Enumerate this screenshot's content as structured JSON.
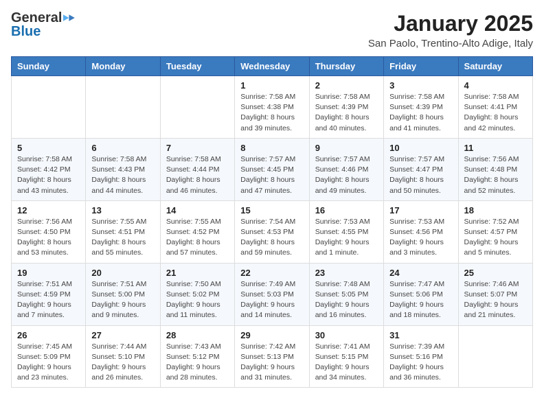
{
  "header": {
    "logo_general": "General",
    "logo_blue": "Blue",
    "month": "January 2025",
    "location": "San Paolo, Trentino-Alto Adige, Italy"
  },
  "weekdays": [
    "Sunday",
    "Monday",
    "Tuesday",
    "Wednesday",
    "Thursday",
    "Friday",
    "Saturday"
  ],
  "weeks": [
    [
      {
        "day": "",
        "info": ""
      },
      {
        "day": "",
        "info": ""
      },
      {
        "day": "",
        "info": ""
      },
      {
        "day": "1",
        "info": "Sunrise: 7:58 AM\nSunset: 4:38 PM\nDaylight: 8 hours\nand 39 minutes."
      },
      {
        "day": "2",
        "info": "Sunrise: 7:58 AM\nSunset: 4:39 PM\nDaylight: 8 hours\nand 40 minutes."
      },
      {
        "day": "3",
        "info": "Sunrise: 7:58 AM\nSunset: 4:39 PM\nDaylight: 8 hours\nand 41 minutes."
      },
      {
        "day": "4",
        "info": "Sunrise: 7:58 AM\nSunset: 4:41 PM\nDaylight: 8 hours\nand 42 minutes."
      }
    ],
    [
      {
        "day": "5",
        "info": "Sunrise: 7:58 AM\nSunset: 4:42 PM\nDaylight: 8 hours\nand 43 minutes."
      },
      {
        "day": "6",
        "info": "Sunrise: 7:58 AM\nSunset: 4:43 PM\nDaylight: 8 hours\nand 44 minutes."
      },
      {
        "day": "7",
        "info": "Sunrise: 7:58 AM\nSunset: 4:44 PM\nDaylight: 8 hours\nand 46 minutes."
      },
      {
        "day": "8",
        "info": "Sunrise: 7:57 AM\nSunset: 4:45 PM\nDaylight: 8 hours\nand 47 minutes."
      },
      {
        "day": "9",
        "info": "Sunrise: 7:57 AM\nSunset: 4:46 PM\nDaylight: 8 hours\nand 49 minutes."
      },
      {
        "day": "10",
        "info": "Sunrise: 7:57 AM\nSunset: 4:47 PM\nDaylight: 8 hours\nand 50 minutes."
      },
      {
        "day": "11",
        "info": "Sunrise: 7:56 AM\nSunset: 4:48 PM\nDaylight: 8 hours\nand 52 minutes."
      }
    ],
    [
      {
        "day": "12",
        "info": "Sunrise: 7:56 AM\nSunset: 4:50 PM\nDaylight: 8 hours\nand 53 minutes."
      },
      {
        "day": "13",
        "info": "Sunrise: 7:55 AM\nSunset: 4:51 PM\nDaylight: 8 hours\nand 55 minutes."
      },
      {
        "day": "14",
        "info": "Sunrise: 7:55 AM\nSunset: 4:52 PM\nDaylight: 8 hours\nand 57 minutes."
      },
      {
        "day": "15",
        "info": "Sunrise: 7:54 AM\nSunset: 4:53 PM\nDaylight: 8 hours\nand 59 minutes."
      },
      {
        "day": "16",
        "info": "Sunrise: 7:53 AM\nSunset: 4:55 PM\nDaylight: 9 hours\nand 1 minute."
      },
      {
        "day": "17",
        "info": "Sunrise: 7:53 AM\nSunset: 4:56 PM\nDaylight: 9 hours\nand 3 minutes."
      },
      {
        "day": "18",
        "info": "Sunrise: 7:52 AM\nSunset: 4:57 PM\nDaylight: 9 hours\nand 5 minutes."
      }
    ],
    [
      {
        "day": "19",
        "info": "Sunrise: 7:51 AM\nSunset: 4:59 PM\nDaylight: 9 hours\nand 7 minutes."
      },
      {
        "day": "20",
        "info": "Sunrise: 7:51 AM\nSunset: 5:00 PM\nDaylight: 9 hours\nand 9 minutes."
      },
      {
        "day": "21",
        "info": "Sunrise: 7:50 AM\nSunset: 5:02 PM\nDaylight: 9 hours\nand 11 minutes."
      },
      {
        "day": "22",
        "info": "Sunrise: 7:49 AM\nSunset: 5:03 PM\nDaylight: 9 hours\nand 14 minutes."
      },
      {
        "day": "23",
        "info": "Sunrise: 7:48 AM\nSunset: 5:05 PM\nDaylight: 9 hours\nand 16 minutes."
      },
      {
        "day": "24",
        "info": "Sunrise: 7:47 AM\nSunset: 5:06 PM\nDaylight: 9 hours\nand 18 minutes."
      },
      {
        "day": "25",
        "info": "Sunrise: 7:46 AM\nSunset: 5:07 PM\nDaylight: 9 hours\nand 21 minutes."
      }
    ],
    [
      {
        "day": "26",
        "info": "Sunrise: 7:45 AM\nSunset: 5:09 PM\nDaylight: 9 hours\nand 23 minutes."
      },
      {
        "day": "27",
        "info": "Sunrise: 7:44 AM\nSunset: 5:10 PM\nDaylight: 9 hours\nand 26 minutes."
      },
      {
        "day": "28",
        "info": "Sunrise: 7:43 AM\nSunset: 5:12 PM\nDaylight: 9 hours\nand 28 minutes."
      },
      {
        "day": "29",
        "info": "Sunrise: 7:42 AM\nSunset: 5:13 PM\nDaylight: 9 hours\nand 31 minutes."
      },
      {
        "day": "30",
        "info": "Sunrise: 7:41 AM\nSunset: 5:15 PM\nDaylight: 9 hours\nand 34 minutes."
      },
      {
        "day": "31",
        "info": "Sunrise: 7:39 AM\nSunset: 5:16 PM\nDaylight: 9 hours\nand 36 minutes."
      },
      {
        "day": "",
        "info": ""
      }
    ]
  ]
}
